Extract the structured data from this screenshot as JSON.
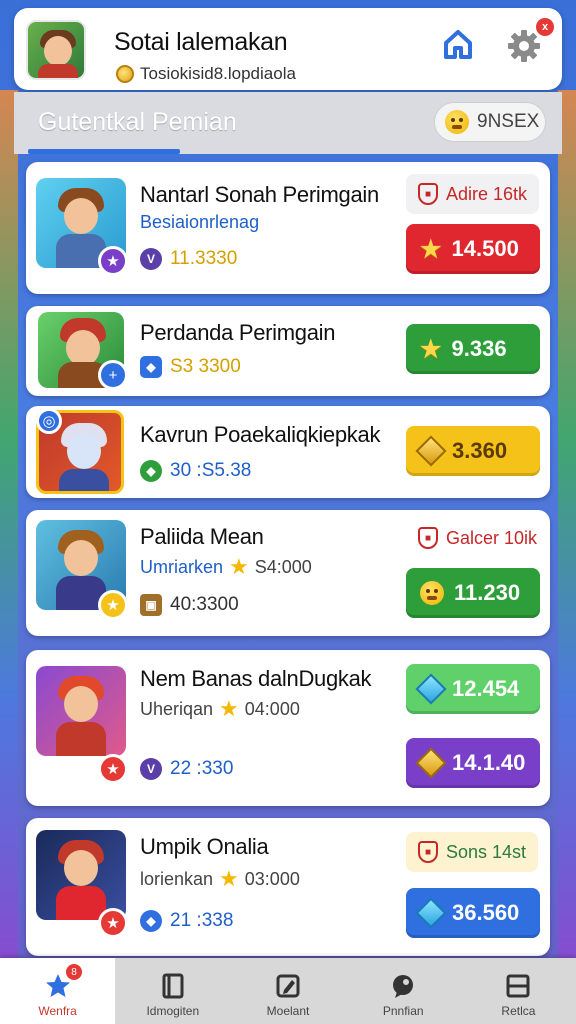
{
  "header": {
    "title": "Sotai lalemakan",
    "subtitle": "Tosiokisid8.lopdiaola"
  },
  "section": {
    "title": "Gutentkal Pemian",
    "pill_label": "9NSEX"
  },
  "games": [
    {
      "title": "Nantarl Sonah Perimgain",
      "subtitle": "Besiaionrlenag",
      "stat": "11.3330",
      "tag": "Adire 16tk",
      "price": "14.500"
    },
    {
      "title": "Perdanda Perimgain",
      "subtitle": "",
      "stat": "S3 3300",
      "tag": "",
      "price": "9.336"
    },
    {
      "title": "Kavrun Poaekaliqkiepkak",
      "subtitle": "",
      "stat": "30 :S5.38",
      "tag": "",
      "price": "3.360"
    },
    {
      "title": "Paliida Mean",
      "subtitle": "Umriarken",
      "subtitle_rating": "S4:000",
      "stat": "40:3300",
      "tag": "Galcer 10ik",
      "price": "11.230"
    },
    {
      "title": "Nem Banas dalnDugkak",
      "subtitle": "Uheriqan",
      "subtitle_rating": "04:000",
      "stat": "22 :330",
      "tag": "",
      "price": "12.454",
      "price2": "14.1.40"
    },
    {
      "title": "Umpik Onalia",
      "subtitle": "lorienkan",
      "subtitle_rating": "03:000",
      "stat": "21 :338",
      "tag": "Sons 14st",
      "price": "36.560"
    }
  ],
  "nav": {
    "items": [
      "Wenfra",
      "Idmogiten",
      "Moelant",
      "Pnnfian",
      "Retlca"
    ],
    "badge": "8"
  },
  "colors": {
    "accent": "#2f6fe0",
    "red": "#e53935",
    "green": "#2e9e3a",
    "yellow": "#f5c21a",
    "purple": "#7a3fc8",
    "blue": "#2f6fe0"
  }
}
